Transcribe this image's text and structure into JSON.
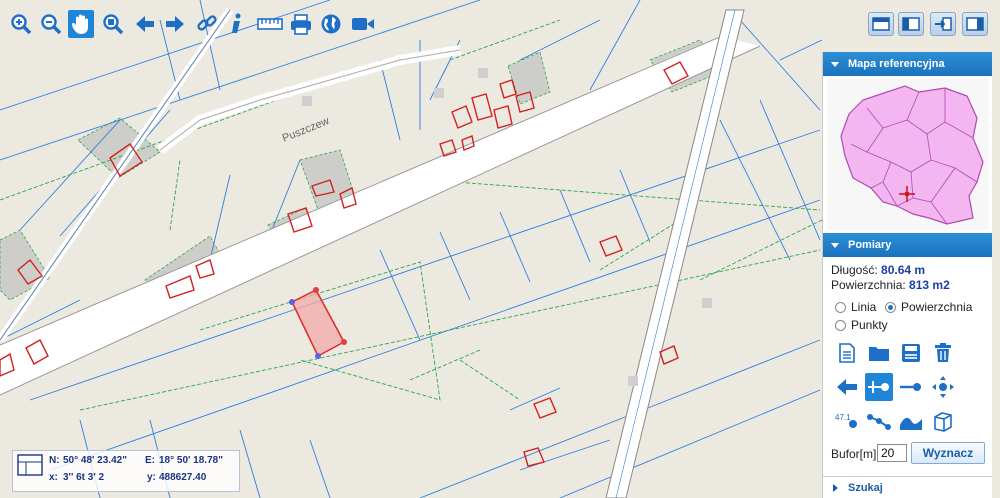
{
  "map": {
    "street_label": "Puszczew"
  },
  "toolbar": {
    "tools": [
      "zoom-in-icon",
      "zoom-out-icon",
      "pan-hand-icon",
      "zoom-extent-icon",
      "back-arrow-icon",
      "forward-arrow-icon",
      "link-icon",
      "info-icon",
      "ruler-icon",
      "print-icon",
      "globe-icon",
      "camera-icon"
    ]
  },
  "window_controls": [
    "layout-top-icon",
    "layout-left-icon",
    "export-icon",
    "layout-right-icon"
  ],
  "panel": {
    "reference_map_title": "Mapa referencyjna",
    "measure_title": "Pomiary",
    "length_label": "Długość:",
    "length_value": "80.64 m",
    "area_label": "Powierzchnia:",
    "area_value": "813 m2",
    "modes": {
      "line": "Linia",
      "area": "Powierzchnia",
      "points": "Punkty",
      "selected": "area"
    },
    "buffer_label": "Bufor[m]",
    "buffer_value": "20",
    "compute_button": "Wyznacz",
    "search_title": "Szukaj"
  },
  "coordinates": {
    "n_label": "N:",
    "n_value": "50° 48' 23.42\"",
    "e_label": "E:",
    "e_value": "18° 50' 18.78\"",
    "x_label": "x:",
    "x_value": "3'' 6t 3' 2",
    "y_label": "y:",
    "y_value": "488627.40"
  },
  "colors": {
    "accent": "#1a72bd",
    "parcel_line": "#2f7fe0",
    "building": "#d42020",
    "measure_fill": "#f4a9a9"
  }
}
